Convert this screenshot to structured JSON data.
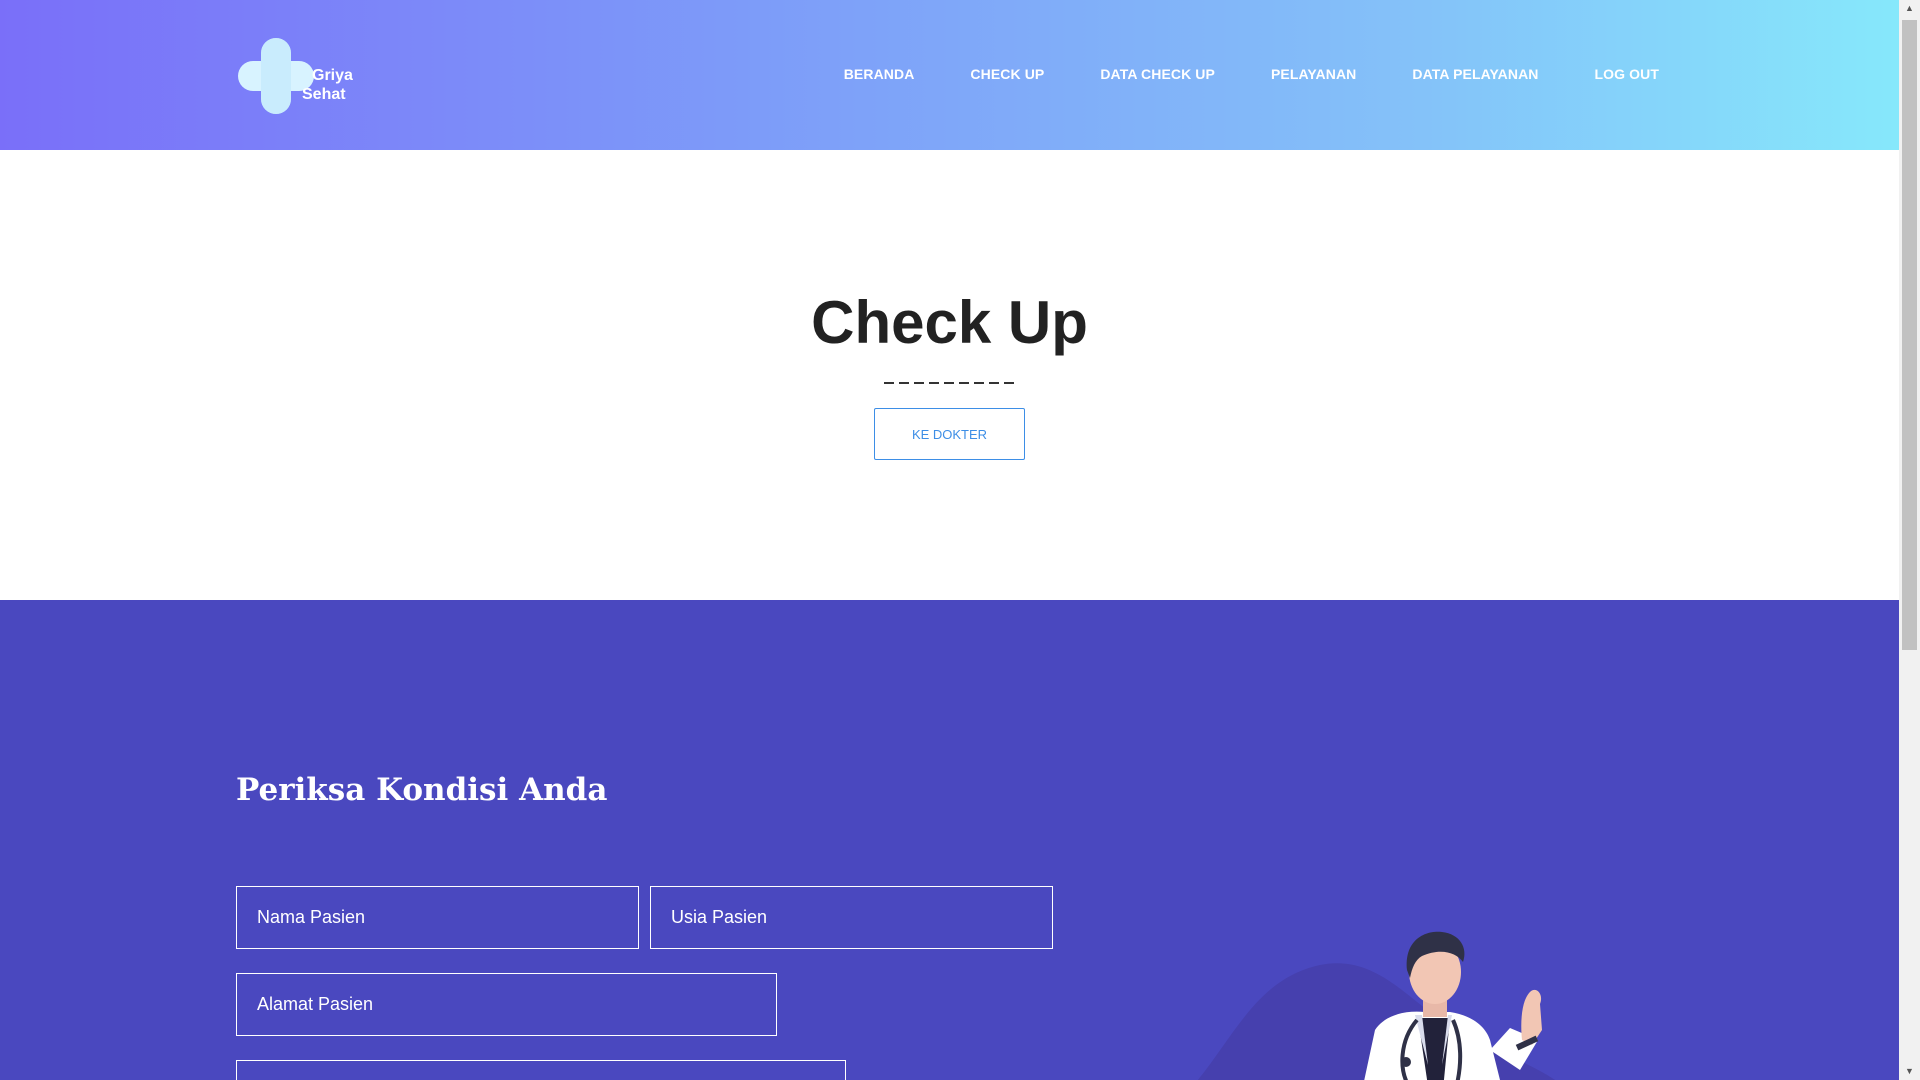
{
  "brand": {
    "line1": "Griya",
    "line2": "Sehat"
  },
  "nav": {
    "items": [
      {
        "label": "BERANDA"
      },
      {
        "label": "CHECK UP"
      },
      {
        "label": "DATA CHECK UP"
      },
      {
        "label": "PELAYANAN"
      },
      {
        "label": "DATA PELAYANAN"
      },
      {
        "label": "LOG OUT"
      }
    ]
  },
  "hero": {
    "title": "Check Up",
    "button_label": "KE DOKTER"
  },
  "form": {
    "title": "Periksa Kondisi Anda",
    "nama_placeholder": "Nama Pasien",
    "usia_placeholder": "Usia Pasien",
    "alamat_placeholder": "Alamat Pasien",
    "extra_placeholder": ""
  },
  "colors": {
    "header_start": "#7a6ff9",
    "header_end": "#86e8fb",
    "section_bg": "#4a48bf",
    "accent": "#3d8ee6"
  },
  "icons": {
    "logo": "medical-cross-icon",
    "scroll_up": "triangle-up-icon",
    "scroll_down": "triangle-down-icon"
  }
}
